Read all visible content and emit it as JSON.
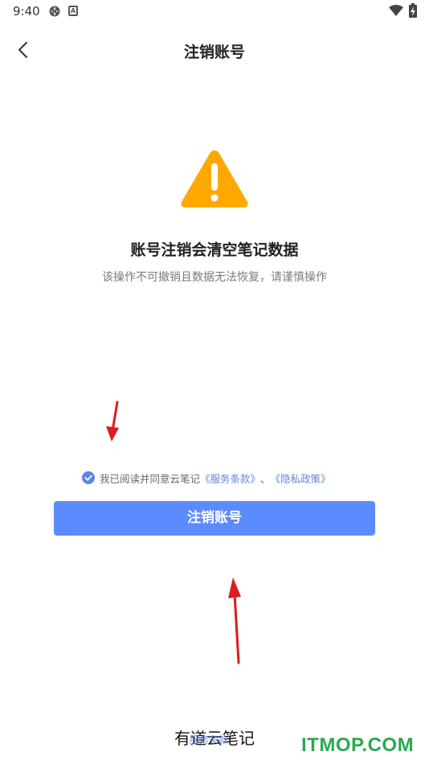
{
  "status_bar": {
    "time": "9:40",
    "icon_a": "settings-gear-icon",
    "icon_b_label": "A",
    "wifi": "wifi-icon",
    "battery": "battery-charging-icon"
  },
  "nav": {
    "back_icon": "chevron-left-icon",
    "title": "注销账号"
  },
  "warning": {
    "icon": "warning-triangle-icon",
    "icon_color": "#ffa800",
    "title": "账号注销会清空笔记数据",
    "subtitle": "该操作不可撤销且数据无法恢复，请谨慎操作"
  },
  "agreement": {
    "checked": true,
    "text": "我已阅读并同意云笔记",
    "terms_link": "《服务条款》",
    "separator": "、",
    "privacy_link": "《隐私政策》",
    "link_color": "#5b86e5"
  },
  "action": {
    "button_label": "注销账号",
    "button_color": "#5b8cff"
  },
  "footer": {
    "app_name": "有道云笔记",
    "overlay_text": "服务条款",
    "watermark": "ITMOP.COM"
  }
}
